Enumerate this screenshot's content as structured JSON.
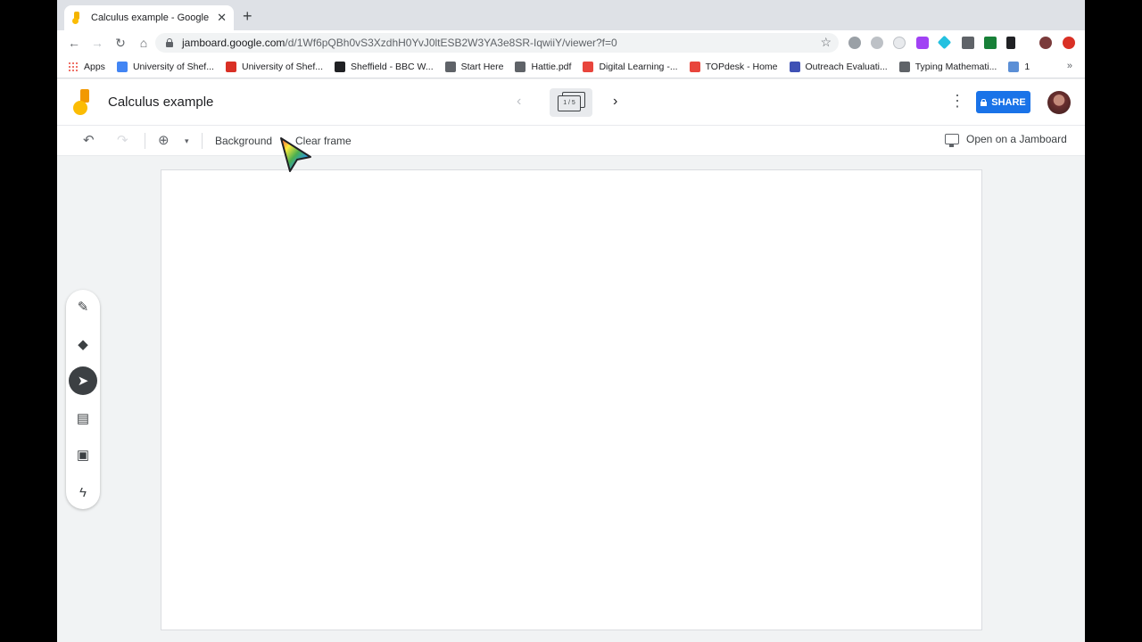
{
  "browser": {
    "tab": {
      "title": "Calculus example - Google Jam",
      "close": "✕"
    },
    "new_tab": "+",
    "nav": {
      "back": "←",
      "forward": "→",
      "reload": "↻",
      "home": "⌂"
    },
    "url": {
      "domain": "jamboard.google.com",
      "path": "/d/1Wf6pQBh0vS3XzdhH0YvJ0ltESB2W3YA3e8SR-IqwiiY/viewer?f=0"
    },
    "star": "☆",
    "bookmarks": [
      {
        "label": "Apps",
        "color": "#ea4335"
      },
      {
        "label": "University of Shef...",
        "color": "#4285f4"
      },
      {
        "label": "University of Shef...",
        "color": "#d93025"
      },
      {
        "label": "Sheffield - BBC W...",
        "color": "#202124"
      },
      {
        "label": "Start Here",
        "color": "#5f6368"
      },
      {
        "label": "Hattie.pdf",
        "color": "#5f6368"
      },
      {
        "label": "Digital Learning -...",
        "color": "#e8453c"
      },
      {
        "label": "TOPdesk - Home",
        "color": "#e8453c"
      },
      {
        "label": "Outreach Evaluati...",
        "color": "#3f51b5"
      },
      {
        "label": "Typing Mathemati...",
        "color": "#5f6368"
      },
      {
        "label": "1",
        "color": "#5b8fd6"
      }
    ],
    "bookmarks_more": "»"
  },
  "jamboard": {
    "title": "Calculus example",
    "frame_counter": "1 / 5",
    "prev_icon": "‹",
    "next_icon": "›",
    "more_icon": "⋮",
    "share_label": "SHARE",
    "toolbar": {
      "undo": "↶",
      "redo": "↷",
      "zoom": "⊕",
      "zoom_caret": "▾",
      "background_label": "Background",
      "clear_frame_label": "Clear frame",
      "open_on_jamboard_label": "Open on a Jamboard"
    },
    "tools": [
      {
        "name": "pen",
        "glyph": "✎",
        "active": false
      },
      {
        "name": "eraser",
        "glyph": "◆",
        "active": false
      },
      {
        "name": "select",
        "glyph": "➤",
        "active": true
      },
      {
        "name": "sticky-note",
        "glyph": "▤",
        "active": false
      },
      {
        "name": "image",
        "glyph": "▣",
        "active": false
      },
      {
        "name": "laser",
        "glyph": "ϟ",
        "active": false
      }
    ]
  },
  "colors": {
    "accent": "#1a73e8",
    "active_tool": "#3c4043"
  }
}
